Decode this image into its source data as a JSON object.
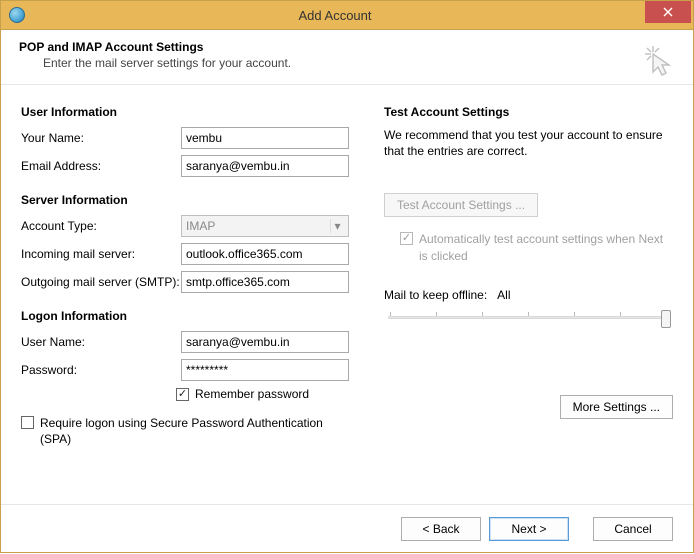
{
  "window": {
    "title": "Add Account",
    "header_title": "POP and IMAP Account Settings",
    "header_sub": "Enter the mail server settings for your account."
  },
  "left": {
    "user_info_title": "User Information",
    "your_name_label": "Your Name:",
    "your_name_value": "vembu",
    "email_label": "Email Address:",
    "email_value": "saranya@vembu.in",
    "server_info_title": "Server Information",
    "account_type_label": "Account Type:",
    "account_type_value": "IMAP",
    "incoming_label": "Incoming mail server:",
    "incoming_value": "outlook.office365.com",
    "outgoing_label": "Outgoing mail server (SMTP):",
    "outgoing_value": "smtp.office365.com",
    "logon_info_title": "Logon Information",
    "username_label": "User Name:",
    "username_value": "saranya@vembu.in",
    "password_label": "Password:",
    "password_value": "*********",
    "remember_pw_label": "Remember password",
    "spa_label": "Require logon using Secure Password Authentication (SPA)"
  },
  "right": {
    "test_title": "Test Account Settings",
    "recommend_text": "We recommend that you test your account to ensure that the entries are correct.",
    "test_btn": "Test Account Settings ...",
    "auto_test_label": "Automatically test account settings when Next is clicked",
    "mail_offline_label": "Mail to keep offline:",
    "mail_offline_value": "All",
    "more_settings_btn": "More Settings ..."
  },
  "footer": {
    "back": "< Back",
    "next": "Next >",
    "cancel": "Cancel"
  }
}
